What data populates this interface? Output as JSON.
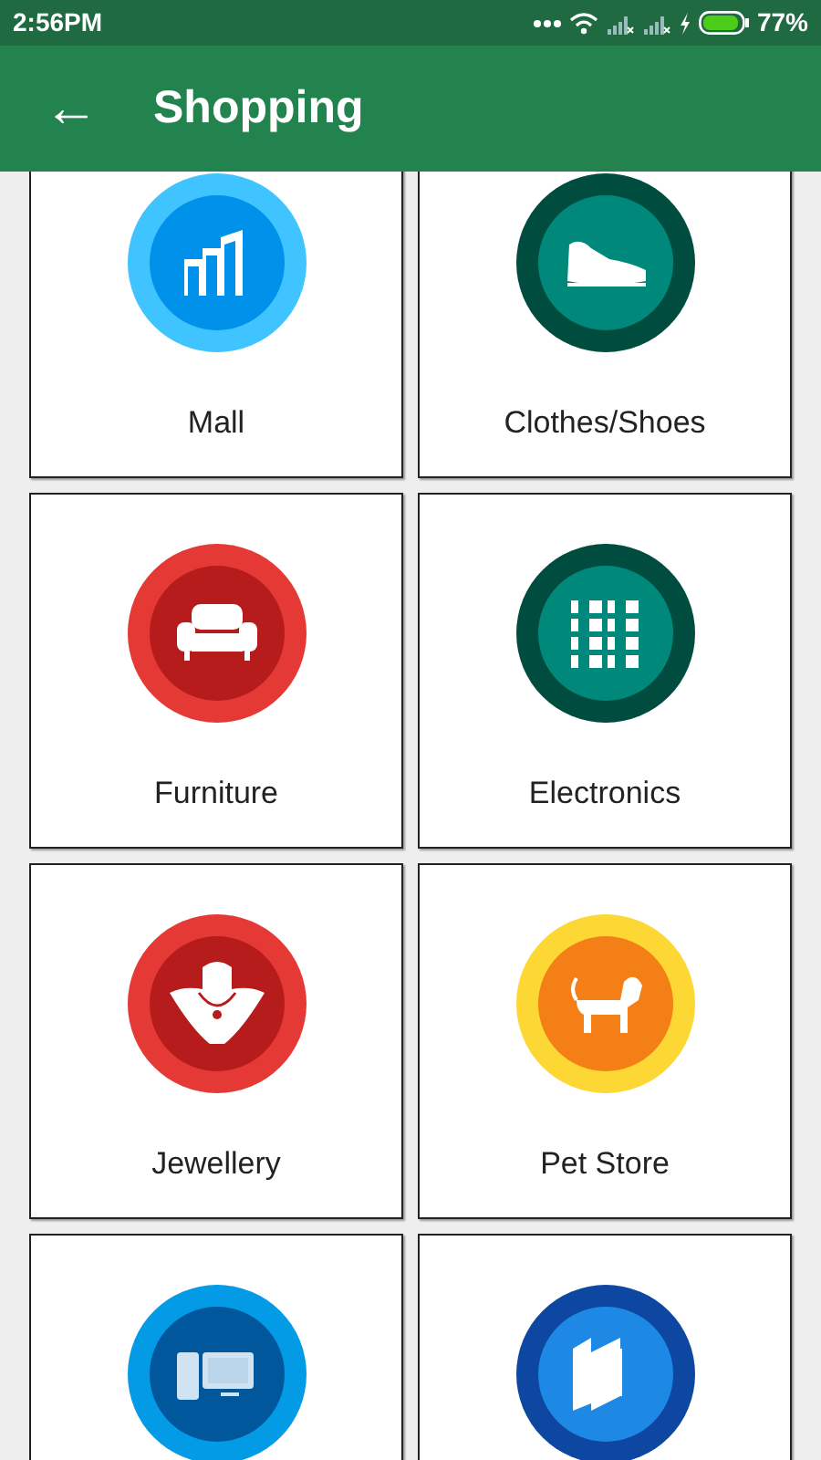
{
  "status_bar": {
    "time": "2:56PM",
    "battery": "77%"
  },
  "app_bar": {
    "back": "←",
    "title": "Shopping"
  },
  "categories": [
    {
      "kind": "mall",
      "label": "Mall"
    },
    {
      "kind": "shoes",
      "label": "Clothes/Shoes"
    },
    {
      "kind": "furniture",
      "label": "Furniture"
    },
    {
      "kind": "electronics",
      "label": "Electronics"
    },
    {
      "kind": "jewellery",
      "label": "Jewellery"
    },
    {
      "kind": "pets",
      "label": "Pet Store"
    },
    {
      "kind": "computers"
    },
    {
      "kind": "books"
    }
  ]
}
